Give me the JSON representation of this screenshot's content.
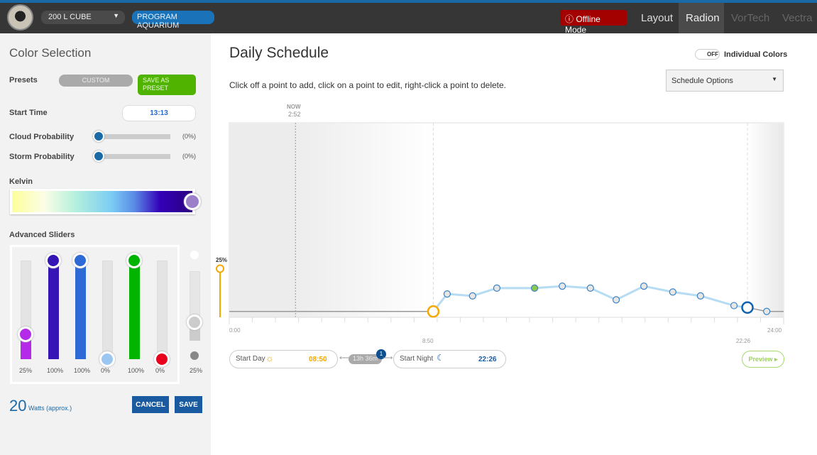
{
  "header": {
    "aquarium": "200 L CUBE",
    "program_button": "PROGRAM AQUARIUM",
    "offline": "Offline Mode",
    "tabs": [
      {
        "label": "Layout",
        "state": "normal"
      },
      {
        "label": "Radion",
        "state": "active"
      },
      {
        "label": "VorTech",
        "state": "disabled"
      },
      {
        "label": "Vectra",
        "state": "disabled"
      }
    ]
  },
  "color_selection": {
    "title": "Color Selection",
    "presets_label": "Presets",
    "preset_value": "CUSTOM",
    "save_preset": "SAVE AS PRESET",
    "start_time_label": "Start Time",
    "start_time": "13:13",
    "cloud_label": "Cloud Probability",
    "cloud_value": "(0%)",
    "cloud": 0,
    "storm_label": "Storm Probability",
    "storm_value": "(0%)",
    "storm": 0,
    "kelvin_label": "Kelvin",
    "kelvin_position": 1.0,
    "advanced_label": "Advanced Sliders",
    "sliders": [
      {
        "label": "25%",
        "value": 25,
        "color": "#b52ae8"
      },
      {
        "label": "100%",
        "value": 100,
        "color": "#3515b5"
      },
      {
        "label": "100%",
        "value": 100,
        "color": "#2e6ad6"
      },
      {
        "label": "0%",
        "value": 0,
        "color": "#9cc6f2"
      },
      {
        "label": "100%",
        "value": 100,
        "color": "#00b400"
      },
      {
        "label": "0%",
        "value": 0,
        "color": "#e8001c"
      }
    ],
    "master": {
      "label": "25%",
      "value": 25
    },
    "watts": "20",
    "watts_label": "Watts (approx.)",
    "cancel": "CANCEL",
    "save": "SAVE"
  },
  "schedule": {
    "title": "Daily Schedule",
    "individual_colors": "Individual Colors",
    "toggle": "OFF",
    "instructions": "Click off a point to add, click on a point to edit, right-click a point to delete.",
    "options": "Schedule Options",
    "now_label": "NOW",
    "now_time": "2:52",
    "selected_intensity": "25%",
    "start_day_label": "Start Day",
    "start_day": "08:50",
    "start_night_label": "Start Night",
    "start_night": "22:26",
    "duration": "13h 36m",
    "badge": "1",
    "preview": "Preview",
    "axis": {
      "start": "0:00",
      "end": "24:00",
      "day_mark": "8:50",
      "night_mark": "22:26"
    }
  },
  "chart_data": {
    "type": "line",
    "xlim": [
      0,
      24
    ],
    "ylim": [
      0,
      100
    ],
    "x_unit": "hours",
    "y_unit": "% intensity",
    "points": [
      {
        "t": "0:00",
        "v": 3
      },
      {
        "t": "8:50",
        "v": 3,
        "kind": "start-day"
      },
      {
        "t": "9:26",
        "v": 12
      },
      {
        "t": "10:32",
        "v": 11
      },
      {
        "t": "11:35",
        "v": 15
      },
      {
        "t": "13:13",
        "v": 15,
        "kind": "selected"
      },
      {
        "t": "14:25",
        "v": 16
      },
      {
        "t": "15:38",
        "v": 15
      },
      {
        "t": "16:45",
        "v": 9
      },
      {
        "t": "17:57",
        "v": 16
      },
      {
        "t": "19:12",
        "v": 13
      },
      {
        "t": "20:24",
        "v": 11
      },
      {
        "t": "21:51",
        "v": 6
      },
      {
        "t": "22:26",
        "v": 5,
        "kind": "start-night"
      },
      {
        "t": "23:16",
        "v": 3
      },
      {
        "t": "24:00",
        "v": 3
      }
    ]
  }
}
